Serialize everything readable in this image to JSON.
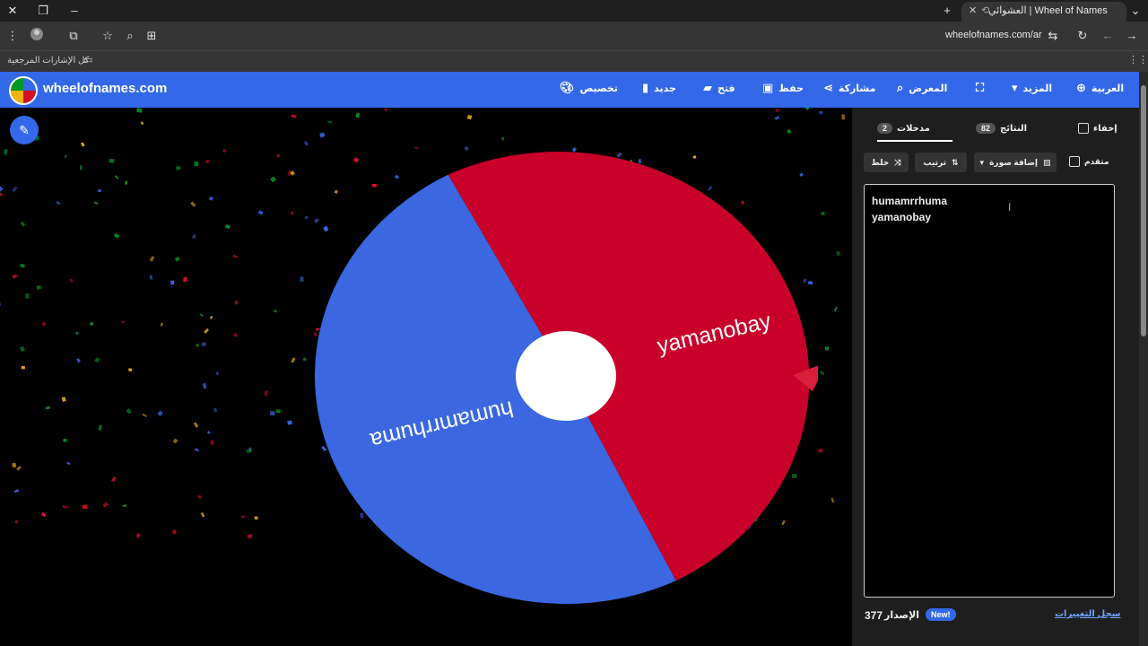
{
  "browser": {
    "tab_title": "العشوائي | Wheel of Names",
    "url": "wheelofnames.com/ar",
    "bookmarks_label": "كل الإشارات المرجعية"
  },
  "header": {
    "site_title": "wheelofnames.com",
    "nav": {
      "language": "العربية",
      "more": "المزيد",
      "gallery": "المعرض",
      "share": "مشاركة",
      "save": "حفظ",
      "open": "فتح",
      "new": "جديد",
      "customize": "تخصيص"
    }
  },
  "wheel": {
    "colors": {
      "blue": "#3b68e1",
      "red": "#c8002a",
      "hub": "#ffffff",
      "pointer": "#d81e3a"
    },
    "slices": [
      {
        "label": "yamanobay",
        "color": "#c8002a"
      },
      {
        "label": "humamrrhuma",
        "color": "#3b68e1"
      }
    ]
  },
  "panel": {
    "tabs": {
      "entries_label": "مدخلات",
      "entries_count": "2",
      "results_label": "النتائج",
      "results_count": "82",
      "hide_label": "إخفاء"
    },
    "buttons": {
      "shuffle": "خلط",
      "sort": "ترتيب",
      "add_image": "إضافة صورة",
      "advanced": "متقدم"
    },
    "entries": [
      "humamrrhuma",
      "yamanobay"
    ],
    "footer": {
      "version_number": "377",
      "version_label": "الإصدار",
      "new_badge": "New!",
      "changelog": "سجل التغييرات"
    }
  }
}
